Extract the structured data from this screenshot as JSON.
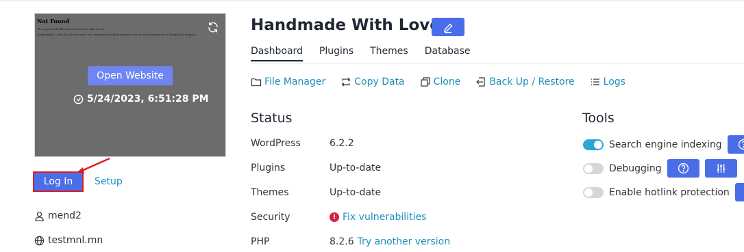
{
  "preview": {
    "page_title": "Not Found",
    "page_line1": "The requested URL was not found on this server.",
    "page_line2": "Additionally, a 404 Not Found error was encountered while trying to use an ErrorDocument to handle the request.",
    "open_button": "Open Website",
    "datetime": "5/24/2023, 6:51:28 PM"
  },
  "account": {
    "login_button": "Log In",
    "setup_link": "Setup",
    "username": "mend2",
    "domain": "testmnl.mn"
  },
  "header": {
    "site_title": "Handmade With Love"
  },
  "tabs": [
    {
      "label": "Dashboard",
      "active": true
    },
    {
      "label": "Plugins",
      "active": false
    },
    {
      "label": "Themes",
      "active": false
    },
    {
      "label": "Database",
      "active": false
    }
  ],
  "actions": [
    {
      "label": "File Manager",
      "icon": "folder-icon"
    },
    {
      "label": "Copy Data",
      "icon": "copy-data-icon"
    },
    {
      "label": "Clone",
      "icon": "clone-icon"
    },
    {
      "label": "Back Up / Restore",
      "icon": "backup-icon"
    },
    {
      "label": "Logs",
      "icon": "logs-icon"
    }
  ],
  "status": {
    "title": "Status",
    "rows": [
      {
        "label": "WordPress",
        "value": "6.2.2"
      },
      {
        "label": "Plugins",
        "value": "Up-to-date"
      },
      {
        "label": "Themes",
        "value": "Up-to-date"
      },
      {
        "label": "Security",
        "value": "Fix vulnerabilities"
      },
      {
        "label": "PHP",
        "value": "8.2.6",
        "link": "Try another version"
      }
    ]
  },
  "tools": {
    "title": "Tools",
    "items": [
      {
        "label": "Search engine indexing",
        "enabled": true
      },
      {
        "label": "Debugging",
        "enabled": false
      },
      {
        "label": "Enable hotlink protection",
        "enabled": false
      }
    ]
  },
  "colors": {
    "accent": "#4a6ee8",
    "link": "#1d8fb8",
    "toggle_on": "#2aa7d6",
    "warning": "#d5213f",
    "highlight": "#e01b22"
  }
}
